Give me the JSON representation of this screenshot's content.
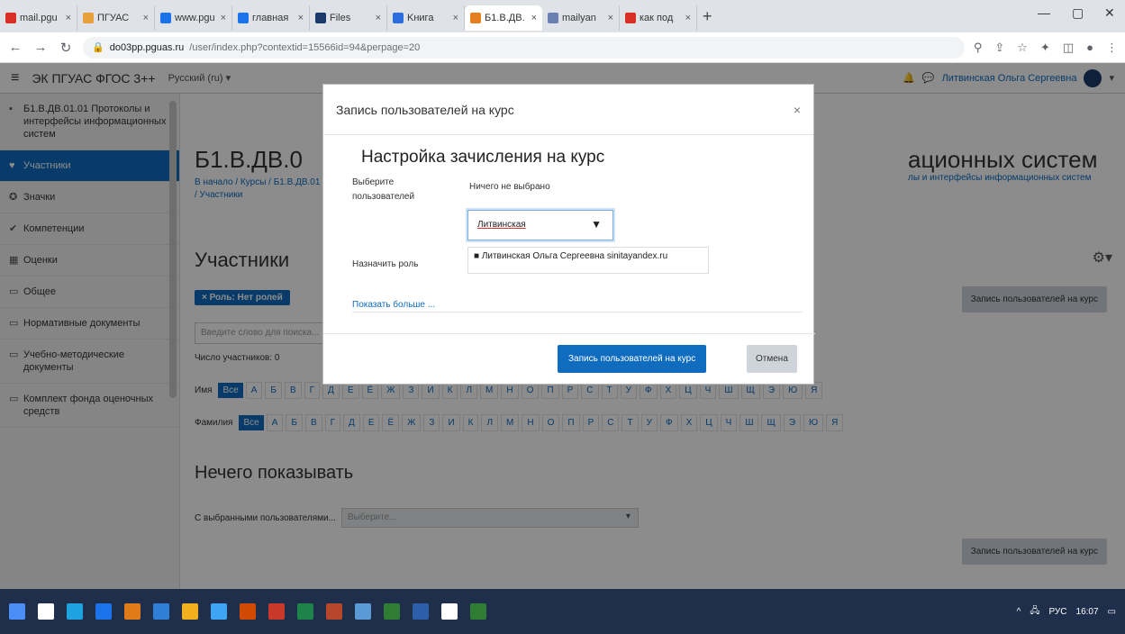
{
  "browser": {
    "tabs": [
      {
        "label": "mail.pgu",
        "color": "#d93025"
      },
      {
        "label": "ПГУАС",
        "color": "#e8a13a"
      },
      {
        "label": "www.pgu",
        "color": "#1a73e8"
      },
      {
        "label": "главная",
        "color": "#1a73e8"
      },
      {
        "label": "Files",
        "color": "#1a3a6b"
      },
      {
        "label": "Kнига",
        "color": "#2a6fdb"
      },
      {
        "label": "Б1.В.ДВ.",
        "color": "#e67e22",
        "active": true
      },
      {
        "label": "mailyan",
        "color": "#6b7fb0"
      },
      {
        "label": "как под",
        "color": "#d93025"
      }
    ],
    "url_host": "do03pp.pguas.ru",
    "url_path": "/user/index.php?contextid=15566id=94&perpage=20"
  },
  "navbar": {
    "site_name": "ЭК ПГУАС ФГОС 3++",
    "language": "Русский (ru) ▾",
    "user_name": "Литвинская Ольга Сергеевна"
  },
  "drawer": {
    "items": [
      {
        "icon": "▪",
        "label": "Б1.В.ДВ.01.01 Протоколы и интерфейсы информационных систем"
      },
      {
        "icon": "♥",
        "label": "Участники",
        "active": true
      },
      {
        "icon": "✪",
        "label": "Значки"
      },
      {
        "icon": "✔",
        "label": "Компетенции"
      },
      {
        "icon": "▦",
        "label": "Оценки"
      },
      {
        "icon": "▭",
        "label": "Общее"
      },
      {
        "icon": "▭",
        "label": "Нормативные документы"
      },
      {
        "icon": "▭",
        "label": "Учебно-методические документы"
      },
      {
        "icon": "▭",
        "label": "Комплект фонда оценочных средств"
      }
    ]
  },
  "main": {
    "course_title_left": "Б1.В.ДВ.0",
    "course_title_right": "ационных систем",
    "breadcrumb_left": "В начало / Курсы / Б1.В.ДВ.01 / Участники",
    "breadcrumb_right": "лы и интерфейсы информационных систем",
    "participants_heading": "Участники",
    "enrol_button_top": "Запись пользователей на курс",
    "enrol_button_bottom": "Запись пользователей на курс",
    "role_chip": "× Роль: Нет ролей",
    "filter_placeholder": "Введите слово для поиска...",
    "participants_count": "Число участников: 0",
    "first_name_label": "Имя",
    "last_name_label": "Фамилия",
    "all_label": "Все",
    "letters": [
      "А",
      "Б",
      "В",
      "Г",
      "Д",
      "Е",
      "Ё",
      "Ж",
      "З",
      "И",
      "К",
      "Л",
      "М",
      "Н",
      "О",
      "П",
      "Р",
      "С",
      "Т",
      "У",
      "Ф",
      "Х",
      "Ц",
      "Ч",
      "Ш",
      "Щ",
      "Э",
      "Ю",
      "Я"
    ],
    "nothing_to_show": "Нечего показывать",
    "with_selected_label": "С выбранными пользователями...",
    "with_selected_placeholder": "Выберите..."
  },
  "modal": {
    "title": "Запись пользователей на курс",
    "close": "×",
    "settings_heading": "Настройка зачисления на курс",
    "select_users_label": "Выберите пользователей",
    "nothing_selected": "Ничего не выбрано",
    "search_value": "Литвинская",
    "suggestion": "Литвинская Ольга Сергеевна sinitayandex.ru",
    "assign_role_label": "Назначить роль",
    "show_more": "Показать больше ...",
    "enrol_button": "Запись пользователей на курс",
    "cancel_button": "Отмена"
  },
  "taskbar": {
    "icons": [
      "#4c8ef7",
      "#ffffff",
      "#1fa3e0",
      "#1a73e8",
      "#e07b1a",
      "#2f7fd6",
      "#f2b01e",
      "#3da5f4",
      "#d04a02",
      "#c8392a",
      "#1d8348",
      "#b7472a",
      "#5b9bd5",
      "#2e7d32",
      "#2d5fa8",
      "#ffffff",
      "#2e7d32"
    ],
    "lang": "РУС",
    "time": "16:07"
  }
}
